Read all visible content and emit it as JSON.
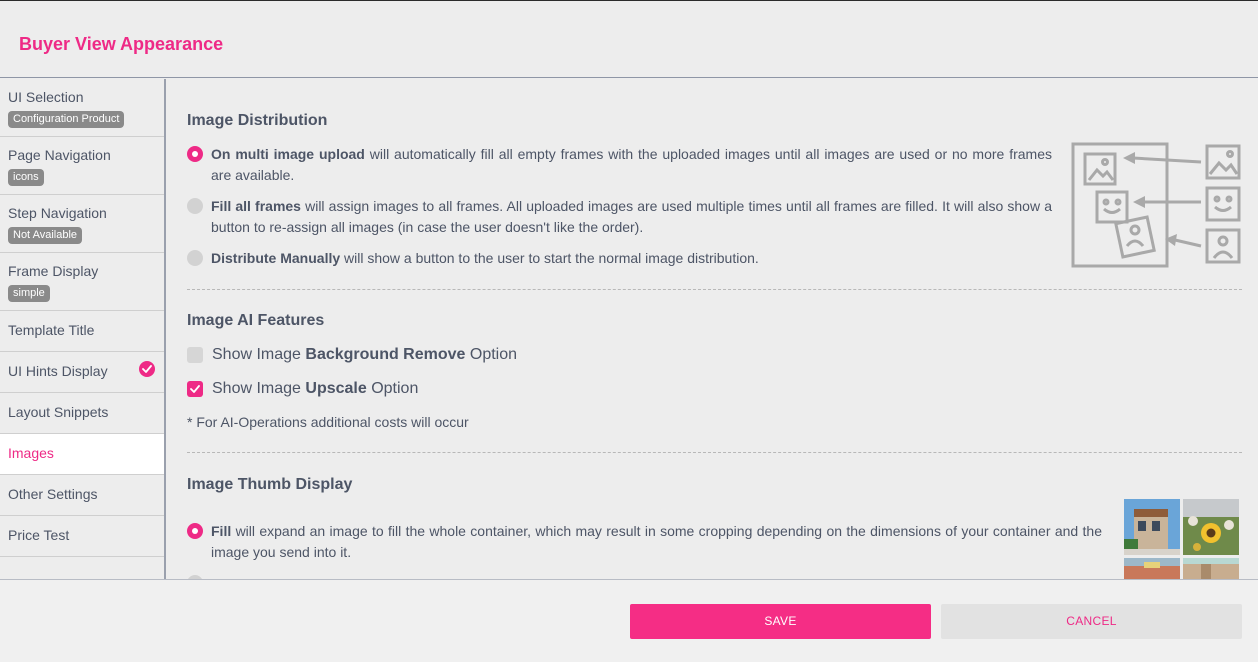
{
  "header": {
    "title": "Buyer View Appearance"
  },
  "sidebar": {
    "items": [
      {
        "label": "UI Selection",
        "badge": "Configuration Product"
      },
      {
        "label": "Page Navigation",
        "badge": "icons"
      },
      {
        "label": "Step Navigation",
        "badge": "Not Available"
      },
      {
        "label": "Frame Display",
        "badge": "simple"
      },
      {
        "label": "Template Title"
      },
      {
        "label": "UI Hints Display"
      },
      {
        "label": "Layout Snippets"
      },
      {
        "label": "Images"
      },
      {
        "label": "Other Settings"
      },
      {
        "label": "Price Test"
      }
    ]
  },
  "image_distribution": {
    "title": "Image Distribution",
    "options": [
      {
        "strong": "On multi image upload",
        "text": " will automatically fill all empty frames with the uploaded images until all images are used or no more frames are available.",
        "selected": true
      },
      {
        "strong": "Fill all frames",
        "text": " will assign images to all frames. All uploaded images are used multiple times until all frames are filled. It will also show a button to re-assign all images (in case the user doesn't like the order).",
        "selected": false
      },
      {
        "strong": "Distribute Manually",
        "text": " will show a button to the user to start the normal image distribution.",
        "selected": false
      }
    ]
  },
  "ai_features": {
    "title": "Image AI Features",
    "bg_remove": {
      "prefix": "Show Image ",
      "strong": "Background Remove",
      "suffix": " Option",
      "checked": false
    },
    "upscale": {
      "prefix": "Show Image ",
      "strong": "Upscale",
      "suffix": " Option",
      "checked": true
    },
    "note": "* For AI-Operations additional costs will occur"
  },
  "thumb_display": {
    "title": "Image Thumb Display",
    "fill": {
      "strong": "Fill",
      "text": " will expand an image to fill the whole container, which may result in some cropping depending on the dimensions of your container and the image you send into it.",
      "selected": true
    }
  },
  "footer": {
    "save": "SAVE",
    "cancel": "CANCEL"
  },
  "colors": {
    "accent": "#ee2a86",
    "text": "#4d5566",
    "background": "#ededed"
  }
}
